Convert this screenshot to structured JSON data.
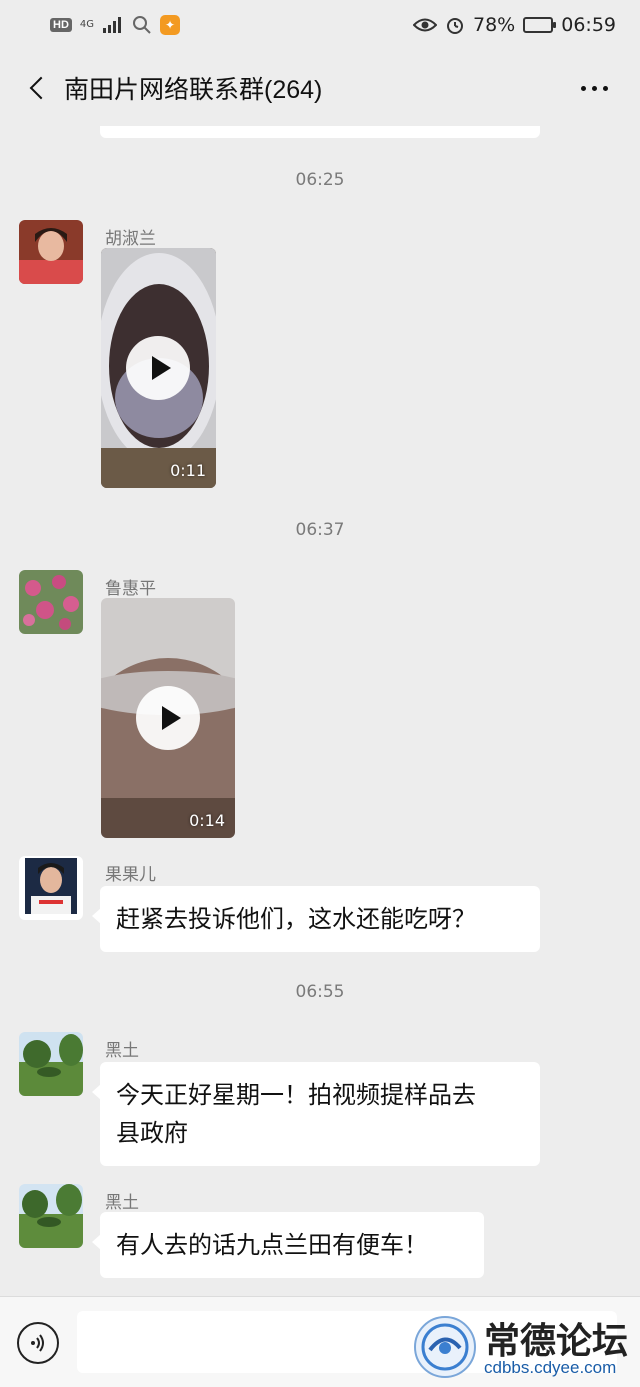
{
  "status_bar": {
    "hd": "HD",
    "network": "4G",
    "battery": "78%",
    "battery_level": 0.78,
    "time": "06:59"
  },
  "header": {
    "title": "南田片网络联系群(264)"
  },
  "messages": [
    {
      "type": "time",
      "text": "06:25"
    },
    {
      "type": "video",
      "sender": "胡淑兰",
      "duration": "0:11"
    },
    {
      "type": "time",
      "text": "06:37"
    },
    {
      "type": "video",
      "sender": "鲁惠平",
      "duration": "0:14"
    },
    {
      "type": "text",
      "sender": "果果儿",
      "text": "赶紧去投诉他们，这水还能吃呀？"
    },
    {
      "type": "time",
      "text": "06:55"
    },
    {
      "type": "text",
      "sender": "黑土",
      "text_line1": "今天正好星期一！拍视频提样品去",
      "text_line2": "县政府"
    },
    {
      "type": "text",
      "sender": "黑土",
      "text": "有人去的话九点兰田有便车！"
    }
  ],
  "watermark": {
    "title": "常德论坛",
    "url": "cdbbs.cdyee.com"
  },
  "colors": {
    "background": "#ededed",
    "bubble": "#ffffff",
    "timestamp": "#7a7a7a"
  }
}
